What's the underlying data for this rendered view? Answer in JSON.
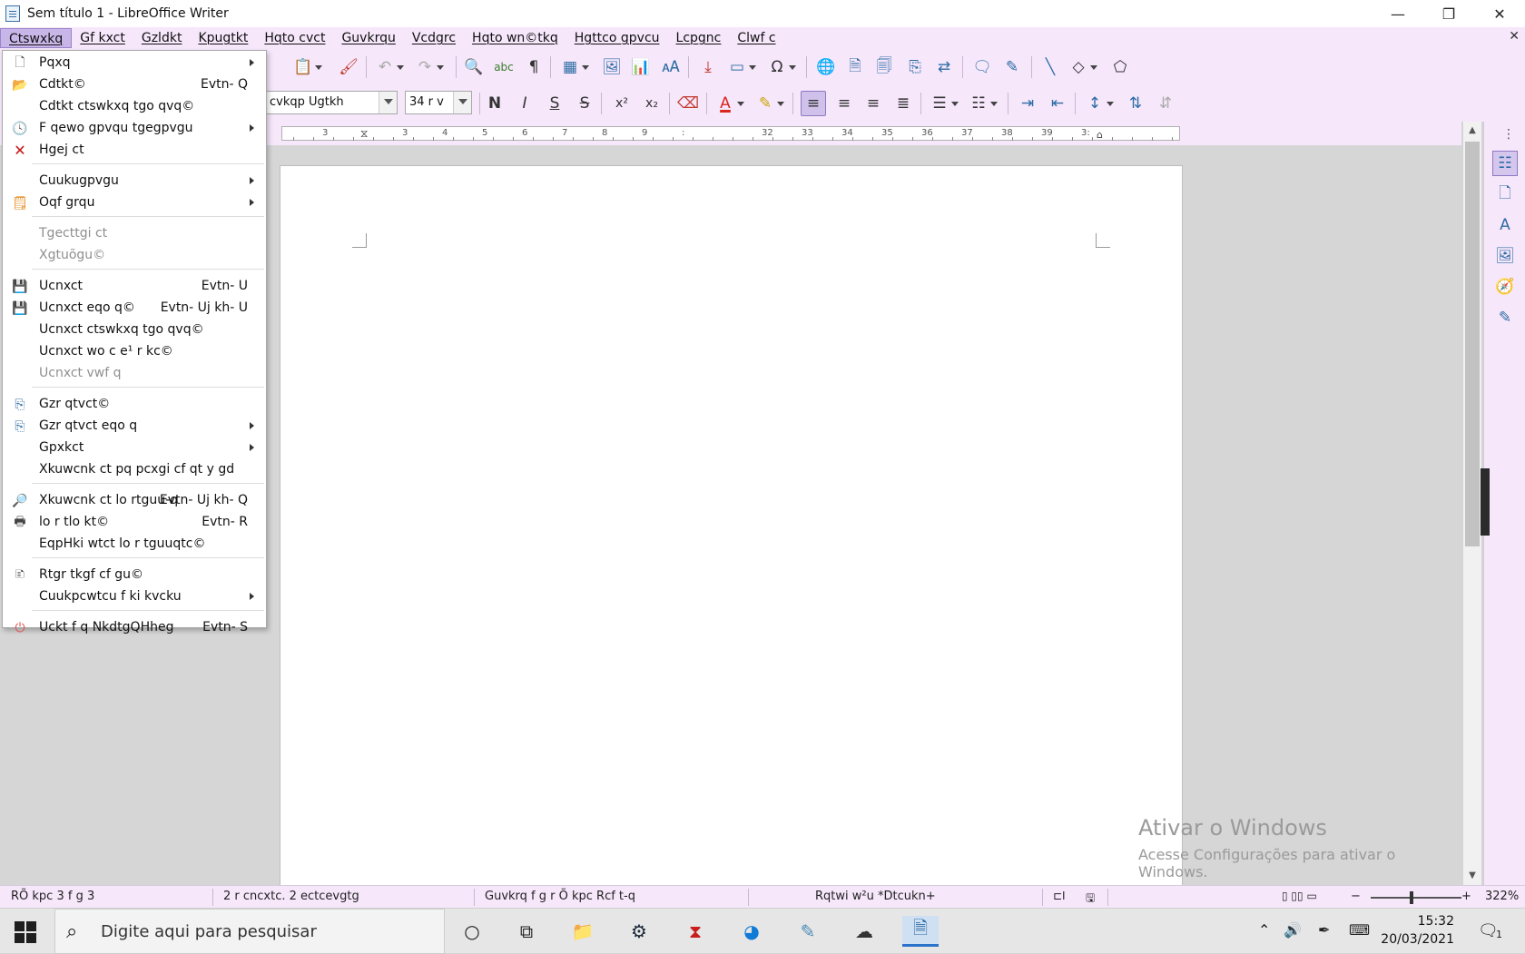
{
  "window": {
    "title": "Sem título 1 - LibreOffice Writer",
    "minimize": "—",
    "maximize": "❐",
    "close": "✕"
  },
  "menubar": {
    "items": [
      "Ctswxkq",
      "Gf kxct",
      "Gzldkt",
      "Kpugtkt",
      "Hqto cvct",
      "Guvkrqu",
      "Vcdgrc",
      "Hqto wn©tkq",
      "Hgttco gpvcu",
      "Lcpgnc",
      "Clwf c"
    ],
    "active_index": 0,
    "close_doc": "✕"
  },
  "toolbar": {
    "font_name": "cvkqp Ugtkh",
    "font_size": "34 r v",
    "bold": "N",
    "italic": "I",
    "underline": "S",
    "strike": "S",
    "superscript": "x²",
    "subscript": "x₂",
    "spellcheck": "abc",
    "formatting_marks": "¶",
    "special_char": "Ω",
    "font_color": "#d9261c",
    "highlight_color": "#ffe600"
  },
  "ruler": {
    "labels": [
      "3",
      "3",
      "4",
      "5",
      "6",
      "7",
      "8",
      "9",
      ":",
      "32",
      "33",
      "34",
      "35",
      "36",
      "37",
      "38",
      "39",
      "3:"
    ]
  },
  "file_menu": {
    "items": [
      {
        "label": "Pqxq",
        "shortcut": "",
        "submenu": true,
        "icon": "new-document-icon",
        "disabled": false
      },
      {
        "label": "Cdtkt©",
        "shortcut": "Evtn- Q",
        "submenu": false,
        "icon": "open-folder-icon",
        "disabled": false
      },
      {
        "label": "Cdtkt ctswkxq tgo qvq©",
        "shortcut": "",
        "submenu": false,
        "icon": "",
        "disabled": false
      },
      {
        "label": "F qewo gpvqu tgegpvgu",
        "shortcut": "",
        "submenu": true,
        "icon": "recent-clock-icon",
        "disabled": false
      },
      {
        "label": "Hgej ct",
        "shortcut": "",
        "submenu": false,
        "icon": "close-document-icon",
        "disabled": false
      },
      {
        "label": "Cuukugpvgu",
        "shortcut": "",
        "submenu": true,
        "icon": "",
        "disabled": false
      },
      {
        "label": "Oqf grqu",
        "shortcut": "",
        "submenu": true,
        "icon": "templates-icon",
        "disabled": false
      },
      {
        "label": "Tgecttgi ct",
        "shortcut": "",
        "submenu": false,
        "icon": "",
        "disabled": true
      },
      {
        "label": "Xgtuõgu©",
        "shortcut": "",
        "submenu": false,
        "icon": "",
        "disabled": true
      },
      {
        "label": "Ucnxct",
        "shortcut": "Evtn- U",
        "submenu": false,
        "icon": "save-icon",
        "disabled": false
      },
      {
        "label": "Ucnxct eqo q©",
        "shortcut": "Evtn- Uj kh- U",
        "submenu": false,
        "icon": "save-as-icon",
        "disabled": false
      },
      {
        "label": "Ucnxct ctswkxq tgo qvq©",
        "shortcut": "",
        "submenu": false,
        "icon": "",
        "disabled": false
      },
      {
        "label": "Ucnxct wo c e¹ r kc©",
        "shortcut": "",
        "submenu": false,
        "icon": "",
        "disabled": false
      },
      {
        "label": "Ucnxct vwf q",
        "shortcut": "",
        "submenu": false,
        "icon": "",
        "disabled": true
      },
      {
        "label": "Gzr qtvct©",
        "shortcut": "",
        "submenu": false,
        "icon": "export-icon",
        "disabled": false
      },
      {
        "label": "Gzr qtvct eqo q",
        "shortcut": "",
        "submenu": true,
        "icon": "export-as-icon",
        "disabled": false
      },
      {
        "label": "Gpxkct",
        "shortcut": "",
        "submenu": true,
        "icon": "",
        "disabled": false
      },
      {
        "label": "Xkuwcnk ct pq pcxgi cf qt y gd",
        "shortcut": "",
        "submenu": false,
        "icon": "",
        "disabled": false
      },
      {
        "label": "Xkuwcnk ct lo rtguu-q",
        "shortcut": "Evtn- Uj kh- Q",
        "submenu": false,
        "icon": "print-preview-icon",
        "disabled": false
      },
      {
        "label": "lo r tlo kt©",
        "shortcut": "Evtn- R",
        "submenu": false,
        "icon": "printer-icon",
        "disabled": false
      },
      {
        "label": "EqpHki wtct lo r tguuqtc©",
        "shortcut": "",
        "submenu": false,
        "icon": "",
        "disabled": false
      },
      {
        "label": "Rtgr tkgf cf gu©",
        "shortcut": "",
        "submenu": false,
        "icon": "properties-icon",
        "disabled": false
      },
      {
        "label": "Cuukpcwtcu f ki kvcku",
        "shortcut": "",
        "submenu": true,
        "icon": "",
        "disabled": false
      },
      {
        "label": "Uckt f q NkdtgQHheg",
        "shortcut": "Evtn- S",
        "submenu": false,
        "icon": "exit-icon",
        "disabled": false
      }
    ]
  },
  "watermark": {
    "line1": "Ativar o Windows",
    "line2": "Acesse Configurações para ativar o Windows."
  },
  "statusbar": {
    "page": "RÕ kpc 3 f g 3",
    "words": "2 r cncxtc. 2 ectcevgtg",
    "style": "Guvkrq f g r Õ kpc Rcf t-q",
    "language": "Rqtwi w²u *Dtcukn+",
    "zoom": "322%"
  },
  "taskbar": {
    "search_placeholder": "Digite aqui para pesquisar",
    "time": "15:32",
    "date": "20/03/2021",
    "notifications": "1"
  }
}
